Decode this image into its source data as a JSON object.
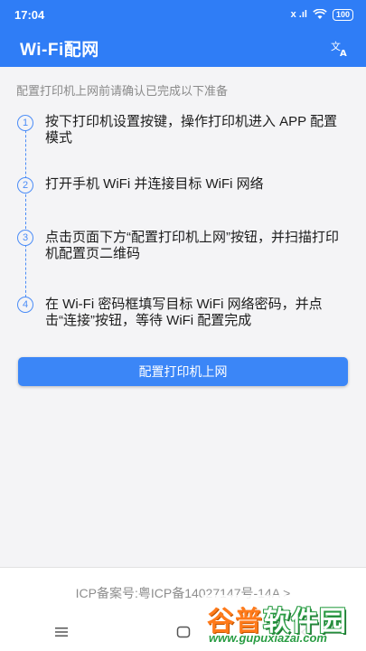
{
  "status_bar": {
    "time": "17:04",
    "signal_text": "x .ıl",
    "battery": "100"
  },
  "app_bar": {
    "title": "Wi-Fi配网",
    "translate_icon": "translate-icon"
  },
  "intro": "配置打印机上网前请确认已完成以下准备",
  "steps": [
    {
      "num": "1",
      "text": "按下打印机设置按键，操作打印机进入 APP 配置模式"
    },
    {
      "num": "2",
      "text": "打开手机 WiFi 并连接目标 WiFi 网络"
    },
    {
      "num": "3",
      "text": "点击页面下方“配置打印机上网”按钮，并扫描打印机配置页二维码"
    },
    {
      "num": "4",
      "text": "在 Wi-Fi 密码框填写目标 WiFi 网络密码，并点击“连接”按钮，等待 WiFi 配置完成"
    }
  ],
  "primary_button": "配置打印机上网",
  "footer": {
    "icp": "ICP备案号:粤ICP备14027147号-14A >"
  },
  "nav": [
    "menu-icon",
    "home-icon",
    "back-icon"
  ],
  "watermark": {
    "title_a": "谷",
    "title_b": "普",
    "title_c": "软件园",
    "url": "www.gupuxiazai.com"
  },
  "colors": {
    "primary": "#2f7df6",
    "button": "#3b86f7",
    "step_accent": "#4a8cf7",
    "background": "#f4f4f6"
  }
}
